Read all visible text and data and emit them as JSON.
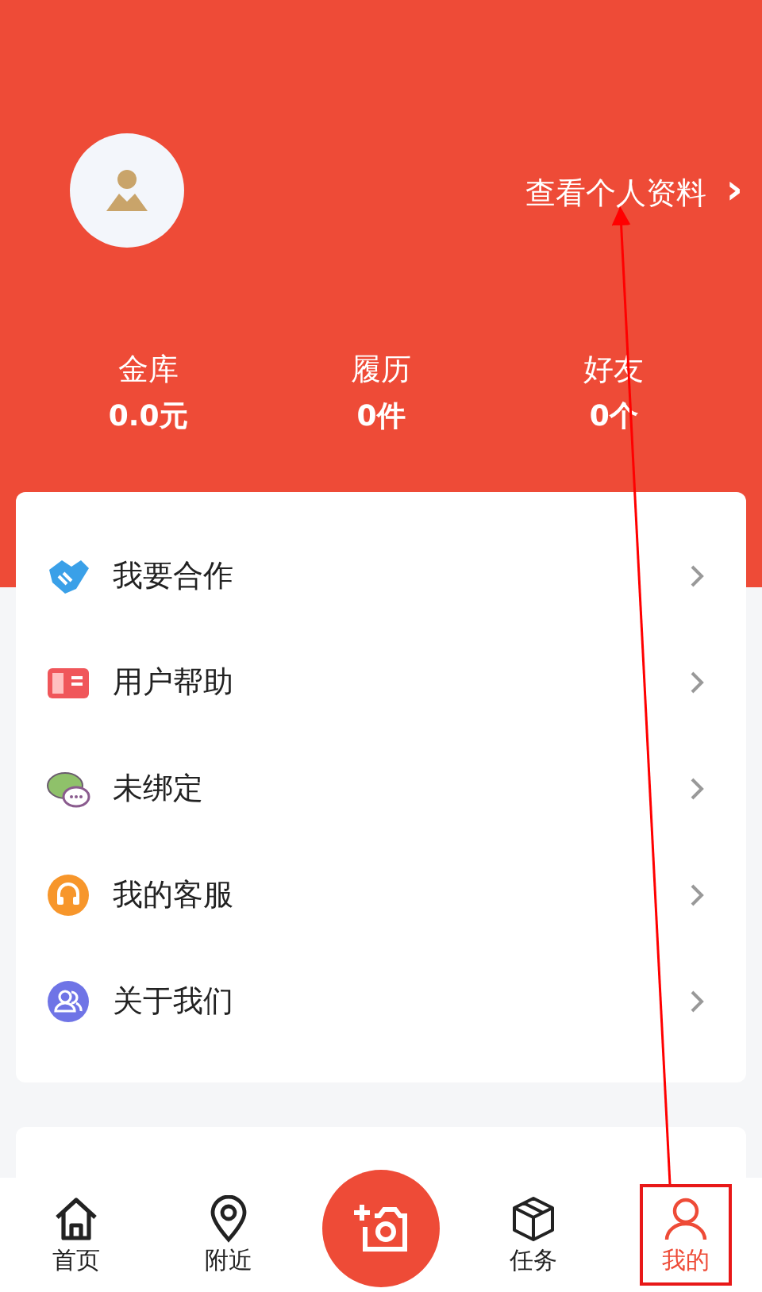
{
  "profile": {
    "link": "查看个人资料",
    "chevron": "›"
  },
  "stats": [
    {
      "label": "金库",
      "value": "0.0元"
    },
    {
      "label": "履历",
      "value": "0件"
    },
    {
      "label": "好友",
      "value": "0个"
    }
  ],
  "menu": [
    {
      "kind": "handshake",
      "label": "我要合作"
    },
    {
      "kind": "book",
      "label": "用户帮助"
    },
    {
      "kind": "chat",
      "label": "未绑定"
    },
    {
      "kind": "headset",
      "label": "我的客服"
    },
    {
      "kind": "people",
      "label": "关于我们"
    }
  ],
  "tabs": [
    {
      "kind": "home",
      "label": "首页",
      "selected": false,
      "highlighted": false
    },
    {
      "kind": "pin",
      "label": "附近",
      "selected": false,
      "highlighted": false
    },
    {
      "kind": "camera"
    },
    {
      "kind": "cube",
      "label": "任务",
      "selected": false,
      "highlighted": false
    },
    {
      "kind": "person",
      "label": "我的",
      "selected": true,
      "highlighted": true
    }
  ]
}
